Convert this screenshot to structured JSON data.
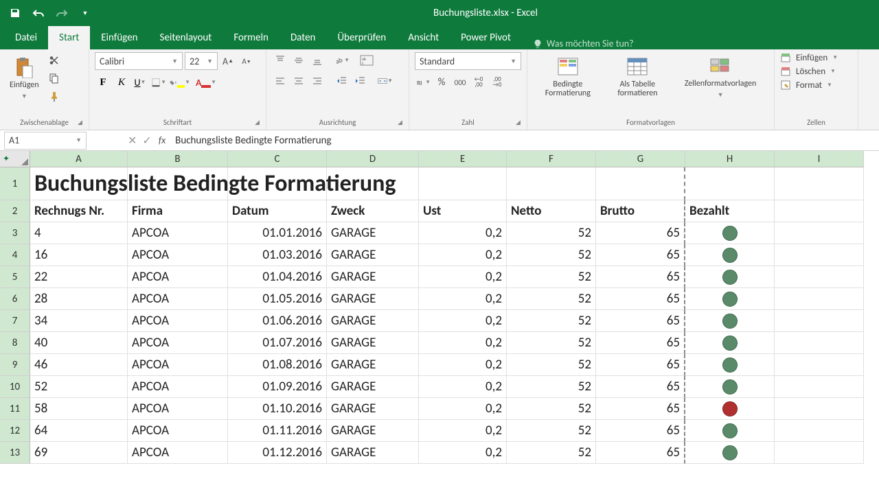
{
  "title": "Buchungsliste.xlsx - Excel",
  "tabs": [
    "Datei",
    "Start",
    "Einfügen",
    "Seitenlayout",
    "Formeln",
    "Daten",
    "Überprüfen",
    "Ansicht",
    "Power Pivot"
  ],
  "active_tab": "Start",
  "tell_me": "Was möchten Sie tun?",
  "ribbon": {
    "clipboard": {
      "paste": "Einfügen",
      "group": "Zwischenablage"
    },
    "font": {
      "name": "Calibri",
      "size": "22",
      "group": "Schriftart"
    },
    "alignment": {
      "group": "Ausrichtung"
    },
    "number": {
      "format": "Standard",
      "group": "Zahl"
    },
    "styles": {
      "cond": "Bedingte\nFormatierung",
      "table": "Als Tabelle\nformatieren",
      "cell": "Zellenformatvorlagen",
      "group": "Formatvorlagen"
    },
    "cells": {
      "insert": "Einfügen",
      "delete": "Löschen",
      "format": "Format",
      "group": "Zellen"
    }
  },
  "name_box": "A1",
  "formula": "Buchungsliste Bedingte Formatierung",
  "columns": [
    {
      "letter": "A",
      "width": 142
    },
    {
      "letter": "B",
      "width": 146
    },
    {
      "letter": "C",
      "width": 144
    },
    {
      "letter": "D",
      "width": 134
    },
    {
      "letter": "E",
      "width": 128
    },
    {
      "letter": "F",
      "width": 130
    },
    {
      "letter": "G",
      "width": 130
    },
    {
      "letter": "H",
      "width": 130
    },
    {
      "letter": "I",
      "width": 130
    }
  ],
  "row_heights": {
    "title": 48,
    "default": 32
  },
  "sheet_title": "Buchungsliste Bedingte Formatierung",
  "headers": [
    "Rechnugs Nr.",
    "Firma",
    "Datum",
    "Zweck",
    "Ust",
    "Netto",
    "Brutto",
    "Bezahlt"
  ],
  "rows": [
    {
      "nr": "4",
      "firma": "APCOA",
      "datum": "01.01.2016",
      "zweck": "GARAGE",
      "ust": "0,2",
      "netto": "52",
      "brutto": "65",
      "bezahlt": "green"
    },
    {
      "nr": "16",
      "firma": "APCOA",
      "datum": "01.03.2016",
      "zweck": "GARAGE",
      "ust": "0,2",
      "netto": "52",
      "brutto": "65",
      "bezahlt": "green"
    },
    {
      "nr": "22",
      "firma": "APCOA",
      "datum": "01.04.2016",
      "zweck": "GARAGE",
      "ust": "0,2",
      "netto": "52",
      "brutto": "65",
      "bezahlt": "green"
    },
    {
      "nr": "28",
      "firma": "APCOA",
      "datum": "01.05.2016",
      "zweck": "GARAGE",
      "ust": "0,2",
      "netto": "52",
      "brutto": "65",
      "bezahlt": "green"
    },
    {
      "nr": "34",
      "firma": "APCOA",
      "datum": "01.06.2016",
      "zweck": "GARAGE",
      "ust": "0,2",
      "netto": "52",
      "brutto": "65",
      "bezahlt": "green"
    },
    {
      "nr": "40",
      "firma": "APCOA",
      "datum": "01.07.2016",
      "zweck": "GARAGE",
      "ust": "0,2",
      "netto": "52",
      "brutto": "65",
      "bezahlt": "green"
    },
    {
      "nr": "46",
      "firma": "APCOA",
      "datum": "01.08.2016",
      "zweck": "GARAGE",
      "ust": "0,2",
      "netto": "52",
      "brutto": "65",
      "bezahlt": "green"
    },
    {
      "nr": "52",
      "firma": "APCOA",
      "datum": "01.09.2016",
      "zweck": "GARAGE",
      "ust": "0,2",
      "netto": "52",
      "brutto": "65",
      "bezahlt": "green"
    },
    {
      "nr": "58",
      "firma": "APCOA",
      "datum": "01.10.2016",
      "zweck": "GARAGE",
      "ust": "0,2",
      "netto": "52",
      "brutto": "65",
      "bezahlt": "red"
    },
    {
      "nr": "64",
      "firma": "APCOA",
      "datum": "01.11.2016",
      "zweck": "GARAGE",
      "ust": "0,2",
      "netto": "52",
      "brutto": "65",
      "bezahlt": "green"
    },
    {
      "nr": "69",
      "firma": "APCOA",
      "datum": "01.12.2016",
      "zweck": "GARAGE",
      "ust": "0,2",
      "netto": "52",
      "brutto": "65",
      "bezahlt": "green"
    }
  ]
}
